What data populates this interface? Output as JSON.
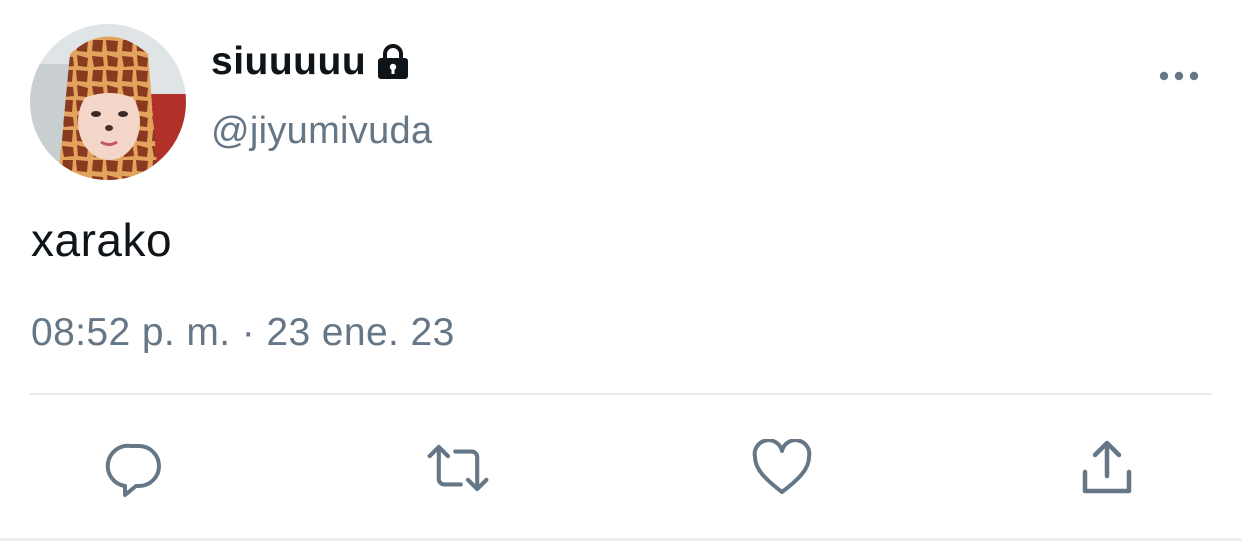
{
  "tweet": {
    "display_name": "siuuuuu",
    "handle": "@jiyumivuda",
    "text": "xarako",
    "timestamp": "08:52 p. m. · 23 ene. 23",
    "protected_icon": "lock-icon",
    "avatar_icon": "avatar"
  },
  "actions": {
    "reply_icon": "reply-icon",
    "retweet_icon": "retweet-icon",
    "like_icon": "heart-icon",
    "share_icon": "share-icon",
    "more_icon": "more-icon"
  },
  "colors": {
    "text": "#0f1419",
    "secondary": "#657786",
    "divider": "#e6ecf0"
  }
}
